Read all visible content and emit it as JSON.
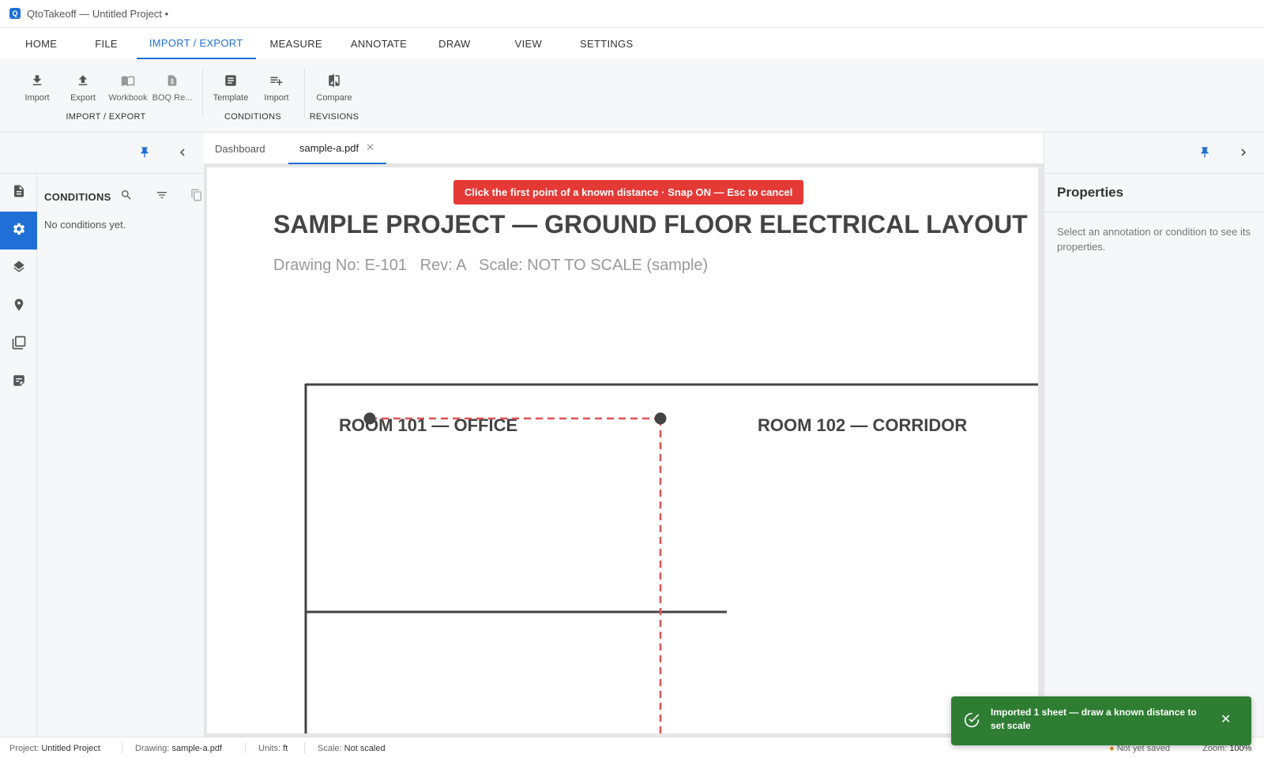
{
  "app": {
    "icon_letter": "Q",
    "title": "QtoTakeoff — Untitled Project •"
  },
  "ribbon_tabs": [
    "HOME",
    "FILE",
    "IMPORT / EXPORT",
    "MEASURE",
    "ANNOTATE",
    "DRAW",
    "VIEW",
    "SETTINGS"
  ],
  "ribbon_active_tab": "IMPORT / EXPORT",
  "ribbon": {
    "import_export": {
      "label": "IMPORT / EXPORT",
      "import": "Import",
      "export": "Export",
      "workbook": "Workbook",
      "boq": "BOQ Re..."
    },
    "conditions": {
      "label": "CONDITIONS",
      "template": "Template",
      "import": "Import"
    },
    "revisions": {
      "label": "REVISIONS",
      "compare": "Compare"
    }
  },
  "left_panel": {
    "title": "CONDITIONS",
    "empty_text": "No conditions yet."
  },
  "doc_tabs": {
    "dashboard": "Dashboard",
    "active": "sample-a.pdf"
  },
  "canvas": {
    "banner": "Click the first point of a known distance · Snap ON — Esc to cancel",
    "drawing_title": "SAMPLE PROJECT — GROUND FLOOR ELECTRICAL LAYOUT",
    "drawing_meta": "Drawing No: E-101   Rev: A   Scale: NOT TO SCALE (sample)",
    "room_101": "ROOM 101 — OFFICE",
    "room_102": "ROOM 102 — CORRIDOR"
  },
  "right_panel": {
    "title": "Properties",
    "hint": "Select an annotation or condition to see its properties."
  },
  "status": {
    "project_label": "Project:",
    "project_value": "Untitled Project",
    "drawing_label": "Drawing:",
    "drawing_value": "sample-a.pdf",
    "units_label": "Units:",
    "units_value": "ft",
    "scale_label": "Scale:",
    "scale_value": "Not scaled",
    "save_state": "Not yet saved",
    "zoom_label": "Zoom:",
    "zoom_value": "100%"
  },
  "toast": {
    "message": "Imported 1 sheet — draw a known distance to set scale"
  },
  "colors": {
    "accent": "#1f6fd6",
    "banner": "#e53935",
    "toast": "#2e7d32",
    "measure_line": "#e05252"
  }
}
